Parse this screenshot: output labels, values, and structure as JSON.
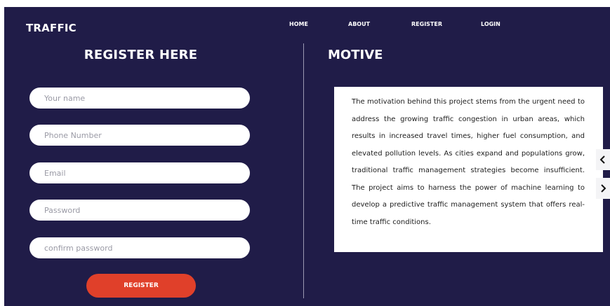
{
  "brand": "TRAFFIC",
  "nav": {
    "home": "HOME",
    "about": "ABOUT",
    "register": "REGISTER",
    "login": "LOGIN"
  },
  "register_section": {
    "title": "REGISTER HERE",
    "fields": {
      "name_placeholder": "Your name",
      "phone_placeholder": "Phone Number",
      "email_placeholder": "Email",
      "password_placeholder": "Password",
      "confirm_placeholder": "confirm password"
    },
    "submit_label": "REGISTER"
  },
  "motive_section": {
    "title": "MOTIVE",
    "text": "The motivation behind this project stems from the urgent need to address the growing traffic congestion in urban areas, which results in increased travel times, higher fuel consumption, and elevated pollution levels. As cities expand and populations grow, traditional traffic management strategies become insufficient. The project aims to harness the power of machine learning to develop a predictive traffic management system that offers real-time traffic conditions."
  },
  "carousel": {
    "prev_icon": "chevron-left-icon",
    "next_icon": "chevron-right-icon"
  },
  "colors": {
    "background": "#201c48",
    "accent": "#e0402a",
    "text_light": "#ffffff"
  }
}
